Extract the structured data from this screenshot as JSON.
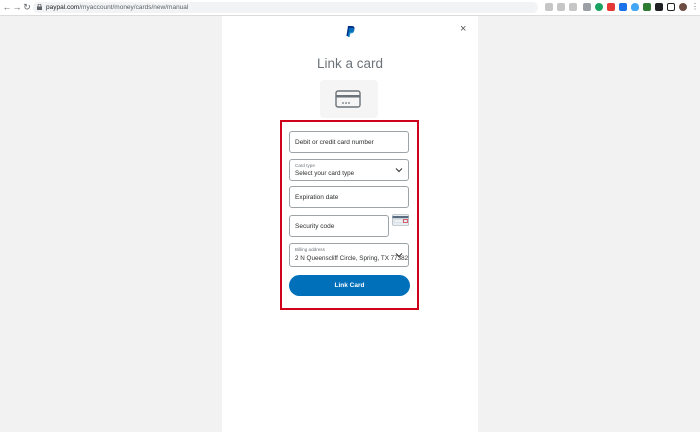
{
  "browser": {
    "url_domain": "paypal.com",
    "url_path": "/myaccount/money/cards/new/manual"
  },
  "page": {
    "title": "Link a card",
    "close_glyph": "×"
  },
  "form": {
    "card_number_placeholder": "Debit or credit card number",
    "card_type_label": "Card type",
    "card_type_value": "Select your card type",
    "expiration_placeholder": "Expiration date",
    "security_code_placeholder": "Security code",
    "billing_label": "Billing address",
    "billing_value": "2 N Queenscliff Circle, Spring, TX 77382",
    "submit_label": "Link Card"
  },
  "colors": {
    "accent": "#0070ba",
    "highlight": "#d0021b"
  },
  "icons": [
    "back-icon",
    "forward-icon",
    "reload-icon",
    "lock-icon",
    "paypal-logo-icon",
    "close-icon",
    "card-icon",
    "chevron-down-icon",
    "cvv-card-icon"
  ]
}
